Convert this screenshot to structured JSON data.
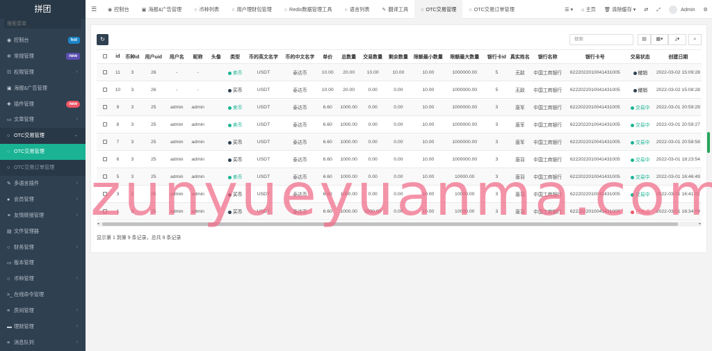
{
  "app": {
    "title": "拼团"
  },
  "sidebar": {
    "search_placeholder": "搜索菜单",
    "items": [
      {
        "label": "控制台",
        "icon": "dashboard-icon",
        "badge": "hot",
        "badge_color": "#1c84c6"
      },
      {
        "label": "常规管理",
        "icon": "cogs-icon",
        "badge": "new",
        "badge_color": "#5a4fb0"
      },
      {
        "label": "权限管理",
        "icon": "group-icon",
        "arrow": "‹"
      },
      {
        "label": "海报&广告管理",
        "icon": "poster-icon"
      },
      {
        "label": "插件管理",
        "icon": "plug-icon",
        "badge": "new",
        "badge_color": "#ed5565"
      },
      {
        "label": "文章管理",
        "icon": "file-icon",
        "arrow": "‹"
      },
      {
        "label": "OTC交易管理",
        "icon": "circle-icon",
        "arrow": "⌄"
      },
      {
        "label": "OTC交易管理",
        "icon": "circle-icon"
      },
      {
        "label": "OTC交易订单管理",
        "icon": "circle-icon"
      },
      {
        "label": "多语言插件",
        "icon": "language-icon",
        "arrow": "‹"
      },
      {
        "label": "会员管理",
        "icon": "user-icon",
        "arrow": "‹"
      },
      {
        "label": "友情链接管理",
        "icon": "link-icon",
        "arrow": "‹"
      },
      {
        "label": "文件管理器",
        "icon": "folder-icon"
      },
      {
        "label": "财务管理",
        "icon": "circle-icon",
        "arrow": "‹"
      },
      {
        "label": "版本管理",
        "icon": "file-icon"
      },
      {
        "label": "币种管理",
        "icon": "circle-icon",
        "arrow": "‹"
      },
      {
        "label": "在线命令管理",
        "icon": "terminal-icon"
      },
      {
        "label": "房间管理",
        "icon": "list-icon",
        "arrow": "‹"
      },
      {
        "label": "理财管理",
        "icon": "wallet-icon",
        "arrow": "‹"
      },
      {
        "label": "消息队列",
        "icon": "list-icon",
        "arrow": "‹"
      }
    ]
  },
  "topbar": {
    "tabs": [
      {
        "label": "控制台",
        "icon": "dashboard-icon"
      },
      {
        "label": "海报&广告管理",
        "icon": "poster-icon"
      },
      {
        "label": "币种列表",
        "icon": "circle-icon"
      },
      {
        "label": "用户理财包管理",
        "icon": "circle-icon"
      },
      {
        "label": "Redis数据管理工具",
        "icon": "circle-icon"
      },
      {
        "label": "语言列表",
        "icon": "circle-icon"
      },
      {
        "label": "翻译工具",
        "icon": "language-icon"
      },
      {
        "label": "OTC交易管理",
        "icon": "circle-icon"
      },
      {
        "label": "OTC交易订单管理",
        "icon": "circle-icon"
      }
    ],
    "home_label": "主页",
    "clear_cache_label": "清除缓存",
    "user_name": "Admin"
  },
  "toolbar": {
    "search_placeholder": "搜索"
  },
  "table": {
    "headers": [
      "id",
      "币种id",
      "用户uid",
      "用户名",
      "昵称",
      "头像",
      "类型",
      "币的英文名字",
      "币的中文名字",
      "单价",
      "总数量",
      "交易数量",
      "剩余数量",
      "限额最小数量",
      "限额最大数量",
      "银行卡id",
      "真实姓名",
      "银行名称",
      "银行卡号",
      "交易状态",
      "创建日期"
    ],
    "rows": [
      [
        "11",
        "3",
        "26",
        "-",
        "-",
        "",
        "卖币",
        "USDT",
        "泰达币",
        "10.00",
        "20.00",
        "10.00",
        "10.00",
        "10.00",
        "1000000.00",
        "5",
        "无敌",
        "中国工商银行",
        "6222022010041431005",
        "撤销",
        "2022-03-02 15:09:28"
      ],
      [
        "10",
        "3",
        "26",
        "-",
        "-",
        "",
        "买币",
        "USDT",
        "泰达币",
        "10.00",
        "20.00",
        "0.00",
        "0.00",
        "10.00",
        "1000000.00",
        "5",
        "无敌",
        "中国工商银行",
        "6222022010041431005",
        "撤销",
        "2022-03-02 15:08:28"
      ],
      [
        "9",
        "3",
        "25",
        "admin",
        "admin",
        "",
        "卖币",
        "USDT",
        "泰达币",
        "6.60",
        "1000.00",
        "0.00",
        "0.00",
        "10.00",
        "1000000.00",
        "3",
        "唐军",
        "中国工商银行",
        "6222022010041431005",
        "交易中",
        "2022-03-01 20:59:29"
      ],
      [
        "8",
        "3",
        "25",
        "admin",
        "admin",
        "",
        "卖币",
        "USDT",
        "泰达币",
        "6.60",
        "1000.00",
        "0.00",
        "0.00",
        "10.00",
        "1000000.00",
        "3",
        "唐军",
        "中国工商银行",
        "6222022010041431005",
        "交易中",
        "2022-03-01 20:59:27"
      ],
      [
        "7",
        "3",
        "25",
        "admin",
        "admin",
        "",
        "买币",
        "USDT",
        "泰达币",
        "6.60",
        "1000.00",
        "0.00",
        "0.00",
        "10.00",
        "1000000.00",
        "3",
        "唐军",
        "中国工商银行",
        "6222022010041431005",
        "交易中",
        "2022-03-01 20:58:58"
      ],
      [
        "6",
        "3",
        "25",
        "admin",
        "admin",
        "",
        "买币",
        "USDT",
        "泰达币",
        "6.60",
        "1000.00",
        "0.00",
        "0.00",
        "10.00",
        "1000000.00",
        "3",
        "唐羽",
        "中国工商银行",
        "6222022010041431005",
        "交易中",
        "2022-03-01 18:23:54"
      ],
      [
        "5",
        "3",
        "25",
        "admin",
        "admin",
        "",
        "卖币",
        "USDT",
        "泰达币",
        "6.60",
        "1000.00",
        "0.00",
        "0.00",
        "10.00",
        "10000.00",
        "3",
        "唐羽",
        "中国工商银行",
        "6222022010041431005",
        "交易中",
        "2022-03-01 16:46:49"
      ],
      [
        "3",
        "3",
        "25",
        "admin",
        "admin",
        "",
        "买币",
        "USDT",
        "泰达币",
        "6.60",
        "1000.00",
        "0.00",
        "0.00",
        "10.00",
        "10000.00",
        "3",
        "唐羽",
        "中国工商银行",
        "6222022010041431005",
        "交易中",
        "2022-03-01 16:41:01"
      ],
      [
        "1",
        "3",
        "25",
        "admin",
        "admin",
        "",
        "买币",
        "USDT",
        "泰达币",
        "6.60",
        "1000.00",
        "1000.00",
        "0.00",
        "10.00",
        "10000.00",
        "3",
        "唐羽",
        "中国工商银行",
        "6222022010041431005",
        "已完成",
        "2022-03-01 16:34:09"
      ]
    ]
  },
  "pagination": {
    "summary": "显示第 1 到第 9 条记录，总共 9 条记录"
  },
  "watermark": {
    "text": "zunyueyuanma.com"
  },
  "colors": {
    "sidebar_bg": "#2f4050",
    "accent": "#1ab394",
    "danger": "#ed5565",
    "dark": "#2f4050"
  }
}
